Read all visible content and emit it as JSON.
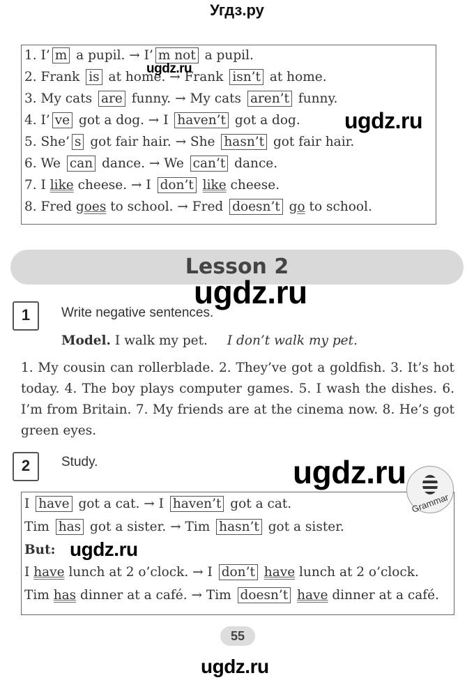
{
  "site_title": "Угдз.ру",
  "watermark": "ugdz.ru",
  "box1_lines": [
    [
      [
        "1. I’",
        ""
      ],
      [
        "m",
        "box"
      ],
      [
        " a pupil. → I’",
        ""
      ],
      [
        "m not",
        "box"
      ],
      [
        " a pupil.",
        ""
      ]
    ],
    [
      [
        "2. Frank ",
        ""
      ],
      [
        "is",
        "box"
      ],
      [
        " at home. → Frank ",
        ""
      ],
      [
        "isn’t",
        "box"
      ],
      [
        " at home.",
        ""
      ]
    ],
    [
      [
        "3. My cats ",
        ""
      ],
      [
        "are",
        "box"
      ],
      [
        " funny. → My cats ",
        ""
      ],
      [
        "aren’t",
        "box"
      ],
      [
        " funny.",
        ""
      ]
    ],
    [
      [
        "4. I’",
        ""
      ],
      [
        "ve",
        "box"
      ],
      [
        " got a dog. → I ",
        ""
      ],
      [
        "haven’t",
        "box"
      ],
      [
        " got a dog.",
        ""
      ]
    ],
    [
      [
        "5. She’",
        ""
      ],
      [
        "s",
        "box"
      ],
      [
        " got fair hair. → She ",
        ""
      ],
      [
        "hasn’t",
        "box"
      ],
      [
        " got fair hair.",
        ""
      ]
    ],
    [
      [
        "6. We ",
        ""
      ],
      [
        "can",
        "box"
      ],
      [
        " dance. → We ",
        ""
      ],
      [
        "can’t",
        "box"
      ],
      [
        " dance.",
        ""
      ]
    ],
    [
      [
        "7. I ",
        ""
      ],
      [
        "like",
        "u"
      ],
      [
        " cheese. → I ",
        ""
      ],
      [
        "don’t",
        "box"
      ],
      [
        " ",
        ""
      ],
      [
        "like",
        "u"
      ],
      [
        " cheese.",
        ""
      ]
    ],
    [
      [
        "8. Fred ",
        ""
      ],
      [
        "goes",
        "u"
      ],
      [
        " to school. → Fred ",
        ""
      ],
      [
        "doesn’t",
        "box"
      ],
      [
        " ",
        ""
      ],
      [
        "go",
        "u"
      ],
      [
        " to school.",
        ""
      ]
    ]
  ],
  "lesson_title": "Lesson 2",
  "exercise1": {
    "number": "1",
    "title": "Write negative sentences.",
    "model_label": "Model.",
    "model_sentence": " I walk my pet.",
    "model_answer": "I don’t walk my pet.",
    "text": "1. My cousin can rollerblade. 2. They’ve got a goldfish. 3. It’s hot today. 4. The boy plays computer games. 5. I wash the dishes. 6. I’m from Britain. 7. My friends are at the cinema now. 8. He’s got green eyes."
  },
  "exercise2": {
    "number": "2",
    "title": "Study.",
    "badge": "Grammar",
    "lines": [
      [
        [
          "I ",
          ""
        ],
        [
          "have",
          "box"
        ],
        [
          " got a cat. → I ",
          ""
        ],
        [
          "haven’t",
          "box"
        ],
        [
          " got a cat.",
          ""
        ]
      ],
      [
        [
          "Tim ",
          ""
        ],
        [
          "has",
          "box"
        ],
        [
          " got a sister. → Tim ",
          ""
        ],
        [
          "hasn’t",
          "box"
        ],
        [
          " got a sister.",
          ""
        ]
      ],
      [
        [
          "But:",
          "bold"
        ]
      ],
      [
        [
          "I ",
          ""
        ],
        [
          "have",
          "u"
        ],
        [
          " lunch at 2 o’clock. → I ",
          ""
        ],
        [
          "don’t",
          "box"
        ],
        [
          " ",
          ""
        ],
        [
          "have",
          "u"
        ],
        [
          " lunch at 2 o’clock.",
          ""
        ]
      ],
      [
        [
          "Tim ",
          ""
        ],
        [
          "has",
          "u"
        ],
        [
          " dinner at a café. → Tim ",
          ""
        ],
        [
          "doesn’t",
          "box"
        ],
        [
          " ",
          ""
        ],
        [
          "have",
          "u"
        ],
        [
          " dinner at a café.",
          ""
        ]
      ]
    ]
  },
  "page_number": "55"
}
